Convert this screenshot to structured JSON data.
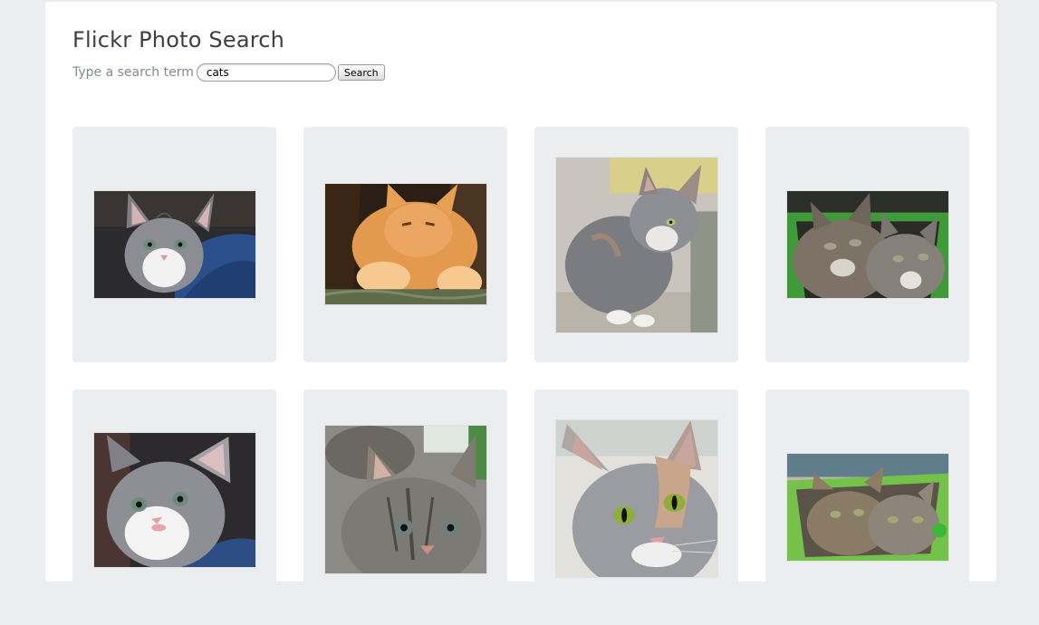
{
  "page": {
    "title": "Flickr Photo Search"
  },
  "search": {
    "label": "Type a search term",
    "value": "cats",
    "button_label": "Search"
  },
  "photos": [
    {
      "subject": "gray-white kitten on blue blanket"
    },
    {
      "subject": "orange tabby cat with paws forward"
    },
    {
      "subject": "gray calico cat sitting"
    },
    {
      "subject": "two tabby kittens in green basket"
    },
    {
      "subject": "gray-white kitten close-up"
    },
    {
      "subject": "tabby kitten close-up"
    },
    {
      "subject": "gray calico cat face with green eyes"
    },
    {
      "subject": "two tabby kittens in green tray"
    }
  ],
  "colors": {
    "background": "#ecedef",
    "container": "#ffffff",
    "title": "#3d3f45",
    "label": "#7f8a98"
  }
}
